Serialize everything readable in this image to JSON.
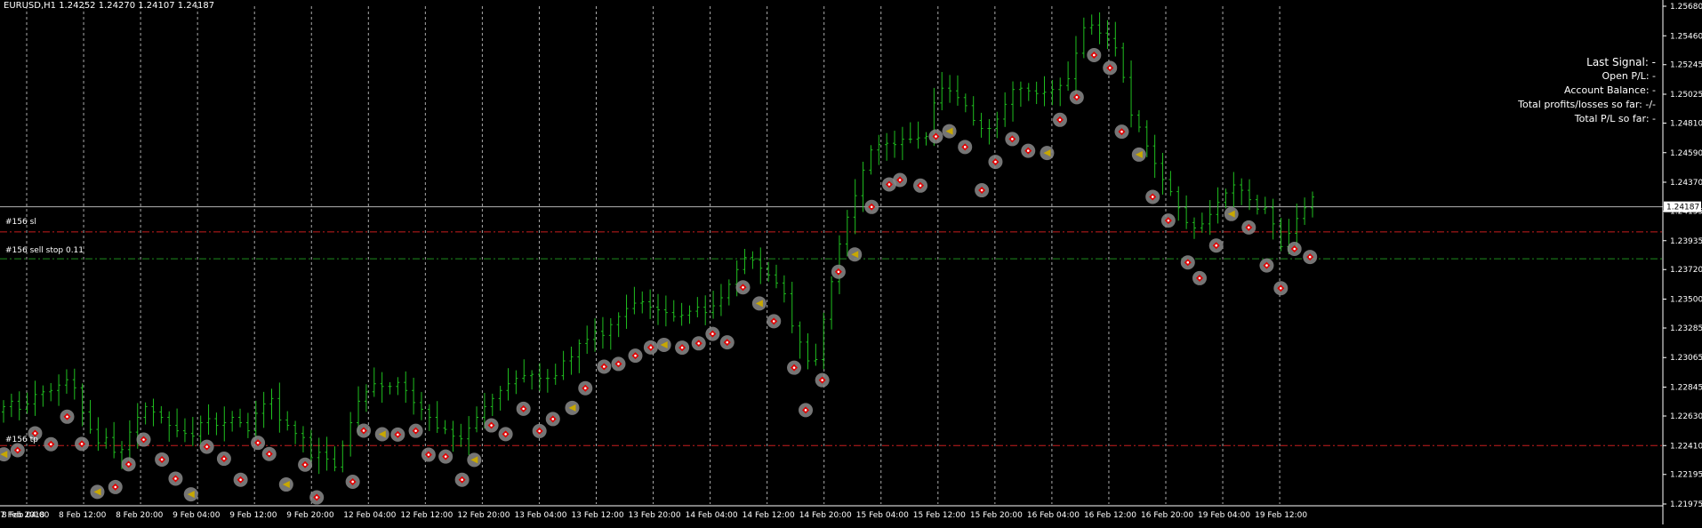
{
  "chart_header": "EURUSD,H1  1.24252 1.24270 1.24107 1.24187",
  "info_panel": [
    "Last Signal: -",
    "Open P/L: -",
    "Account Balance: -",
    "Total profits/losses so far: -/-",
    "Total P/L so far: -"
  ],
  "order_labels": {
    "sl": "#156 sl",
    "sell_stop": "#156 sell stop 0.11",
    "tp": "#156 tp"
  },
  "colors": {
    "background": "#000000",
    "candle": "#1fbf1f",
    "grid": "#c8c8c8",
    "order_line": "#c81e1e",
    "entry_line": "#1e8c1e",
    "bid_line": "#b4b4b4",
    "marker_ring": "#8a8a8a",
    "marker_red": "#e00000",
    "marker_triangle": "#c8a800"
  },
  "chart_data": {
    "type": "candlestick",
    "symbol": "EURUSD",
    "timeframe": "H1",
    "ohlc": {
      "open": 1.24252,
      "high": 1.2427,
      "low": 1.24107,
      "close": 1.24187
    },
    "ylim": [
      1.21975,
      1.2568
    ],
    "y_ticks": [
      "1.25680",
      "1.25460",
      "1.25245",
      "1.25025",
      "1.24810",
      "1.24590",
      "1.24370",
      "1.24155",
      "1.23935",
      "1.23720",
      "1.23500",
      "1.23285",
      "1.23065",
      "1.22845",
      "1.22630",
      "1.22410",
      "1.22195",
      "1.21975"
    ],
    "current_price": "1.24187",
    "x_ticks": [
      "7 Feb 2018",
      "8 Feb 04:00",
      "8 Feb 12:00",
      "8 Feb 20:00",
      "9 Feb 04:00",
      "9 Feb 12:00",
      "9 Feb 20:00",
      "12 Feb 04:00",
      "12 Feb 12:00",
      "12 Feb 20:00",
      "13 Feb 04:00",
      "13 Feb 12:00",
      "13 Feb 20:00",
      "14 Feb 04:00",
      "14 Feb 12:00",
      "14 Feb 20:00",
      "15 Feb 04:00",
      "15 Feb 12:00",
      "15 Feb 20:00",
      "16 Feb 04:00",
      "16 Feb 12:00",
      "16 Feb 20:00",
      "19 Feb 04:00",
      "19 Feb 12:00"
    ],
    "levels": {
      "sl": 1.24,
      "sell_stop": 1.238,
      "tp": 1.2241
    },
    "closes": [
      1.227,
      1.2274,
      1.2268,
      1.2272,
      1.2279,
      1.2281,
      1.2282,
      1.2286,
      1.229,
      1.2284,
      1.2266,
      1.2253,
      1.2243,
      1.2247,
      1.2236,
      1.2238,
      1.2251,
      1.2262,
      1.227,
      1.2266,
      1.2262,
      1.2256,
      1.2252,
      1.225,
      1.2248,
      1.2258,
      1.2261,
      1.2256,
      1.2258,
      1.2262,
      1.2258,
      1.2252,
      1.2265,
      1.2272,
      1.2276,
      1.226,
      1.2256,
      1.225,
      1.2247,
      1.2232,
      1.2236,
      1.2231,
      1.2225,
      1.2241,
      1.2258,
      1.2274,
      1.2281,
      1.2287,
      1.2285,
      1.2285,
      1.2288,
      1.2282,
      1.2273,
      1.2268,
      1.2262,
      1.2254,
      1.2253,
      1.2248,
      1.2246,
      1.2254,
      1.2262,
      1.227,
      1.2276,
      1.2282,
      1.2287,
      1.2291,
      1.2293,
      1.2294,
      1.2291,
      1.2291,
      1.2293,
      1.2304,
      1.2307,
      1.2317,
      1.232,
      1.2326,
      1.2323,
      1.2331,
      1.2337,
      1.2343,
      1.2347,
      1.2348,
      1.2344,
      1.2342,
      1.234,
      1.2337,
      1.2338,
      1.2341,
      1.2344,
      1.234,
      1.2345,
      1.2351,
      1.2361,
      1.2372,
      1.2381,
      1.2379,
      1.2373,
      1.2368,
      1.2362,
      1.2354,
      1.233,
      1.2318,
      1.2304,
      1.2305,
      1.2335,
      1.2363,
      1.2391,
      1.2411,
      1.2427,
      1.2446,
      1.2461,
      1.2465,
      1.2466,
      1.2465,
      1.2469,
      1.2469,
      1.247,
      1.2471,
      1.2496,
      1.2507,
      1.2505,
      1.25,
      1.2494,
      1.2483,
      1.2477,
      1.2477,
      1.2484,
      1.2495,
      1.2506,
      1.2507,
      1.2505,
      1.2503,
      1.2504,
      1.2506,
      1.2509,
      1.2514,
      1.2533,
      1.2552,
      1.2554,
      1.2548,
      1.2544,
      1.2537,
      1.2515,
      1.2487,
      1.2478,
      1.2464,
      1.2451,
      1.2439,
      1.243,
      1.2418,
      1.2407,
      1.2403,
      1.2406,
      1.2413,
      1.2422,
      1.2429,
      1.2435,
      1.2431,
      1.2424,
      1.2417,
      1.2418,
      1.2406,
      1.2389,
      1.2399,
      1.241,
      1.2418,
      1.2426
    ]
  }
}
